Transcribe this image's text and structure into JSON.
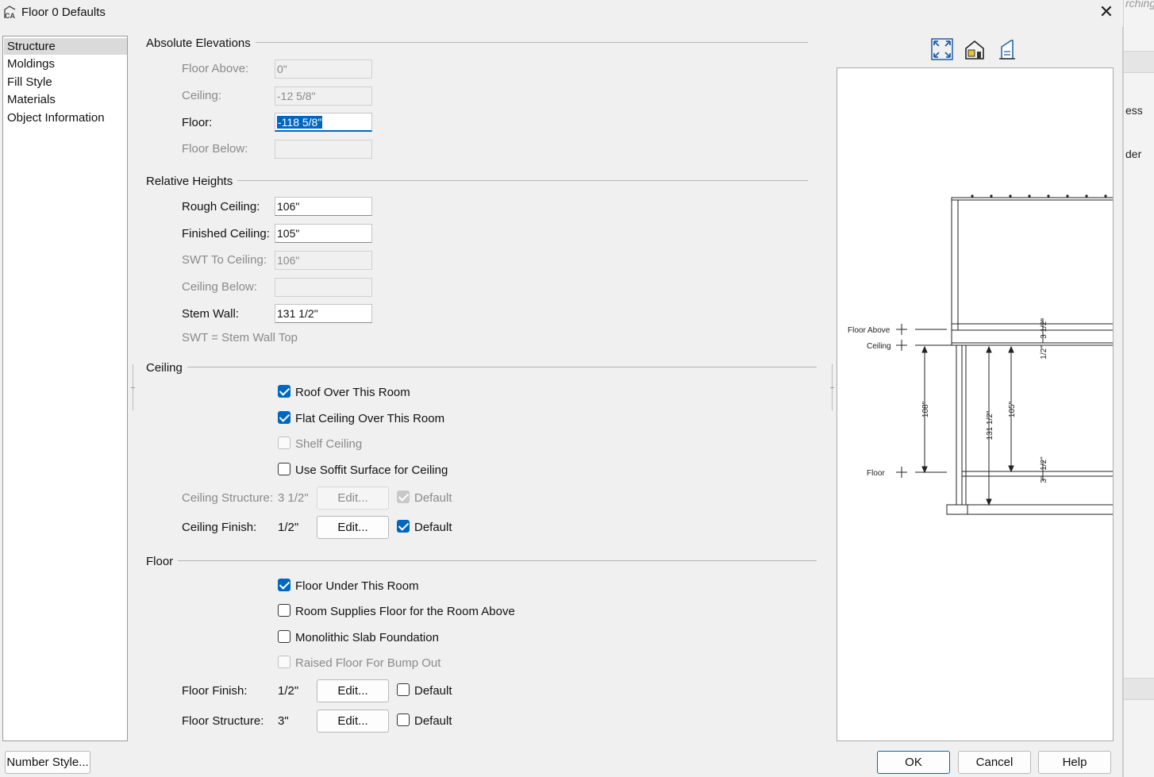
{
  "window": {
    "title": "Floor 0 Defaults",
    "close_label": "✕"
  },
  "background_window": {
    "text1": "rching",
    "text2": "ess",
    "text3": "der"
  },
  "nav": {
    "items": [
      "Structure",
      "Moldings",
      "Fill Style",
      "Materials",
      "Object Information"
    ],
    "selected": 0
  },
  "absolute_elevations": {
    "title": "Absolute Elevations",
    "floor_above": {
      "label": "Floor Above:",
      "value": "0\""
    },
    "ceiling": {
      "label": "Ceiling:",
      "value": "-12 5/8\""
    },
    "floor": {
      "label": "Floor:",
      "value": "-118 5/8\""
    },
    "floor_below": {
      "label": "Floor Below:",
      "value": ""
    }
  },
  "relative_heights": {
    "title": "Relative Heights",
    "rough_ceiling": {
      "label": "Rough Ceiling:",
      "value": "106\""
    },
    "finished_ceiling": {
      "label": "Finished Ceiling:",
      "value": "105\""
    },
    "swt_to_ceiling": {
      "label": "SWT To Ceiling:",
      "value": "106\""
    },
    "ceiling_below": {
      "label": "Ceiling Below:",
      "value": ""
    },
    "stem_wall": {
      "label": "Stem Wall:",
      "value": "131 1/2\""
    },
    "note": "SWT = Stem Wall Top"
  },
  "ceiling": {
    "title": "Ceiling",
    "roof_over": {
      "label": "Roof Over This Room",
      "checked": true
    },
    "flat_ceiling": {
      "label": "Flat Ceiling Over This Room",
      "checked": true
    },
    "shelf_ceiling": {
      "label": "Shelf Ceiling",
      "checked": false
    },
    "soffit": {
      "label": "Use Soffit Surface for Ceiling",
      "checked": false
    },
    "structure": {
      "label": "Ceiling Structure:",
      "value": "3 1/2\"",
      "edit": "Edit...",
      "default_label": "Default",
      "default_checked": true
    },
    "finish": {
      "label": "Ceiling Finish:",
      "value": "1/2\"",
      "edit": "Edit...",
      "default_label": "Default",
      "default_checked": true
    }
  },
  "floor": {
    "title": "Floor",
    "under": {
      "label": "Floor Under This Room",
      "checked": true
    },
    "supplies": {
      "label": "Room Supplies Floor for the Room Above",
      "checked": false
    },
    "monolithic": {
      "label": "Monolithic Slab Foundation",
      "checked": false
    },
    "raised": {
      "label": "Raised Floor For Bump Out",
      "checked": false
    },
    "finish": {
      "label": "Floor Finish:",
      "value": "1/2\"",
      "edit": "Edit...",
      "default_label": "Default",
      "default_checked": false
    },
    "structure": {
      "label": "Floor Structure:",
      "value": "3\"",
      "edit": "Edit...",
      "default_label": "Default",
      "default_checked": false
    }
  },
  "preview": {
    "tools": [
      "fit-view-icon",
      "house-camera-icon",
      "elevation-view-icon"
    ],
    "labels": {
      "floor_above": "Floor Above",
      "ceiling": "Ceiling",
      "floor": "Floor"
    },
    "dims": {
      "d1": "3 1/2\"",
      "d2": "1/2\"",
      "d3": "108\"",
      "d4": "131 1/2\"",
      "d5": "105\"",
      "d6": "1/2\"",
      "d7": "3\""
    }
  },
  "footer": {
    "number_style": "Number Style...",
    "ok": "OK",
    "cancel": "Cancel",
    "help": "Help"
  }
}
